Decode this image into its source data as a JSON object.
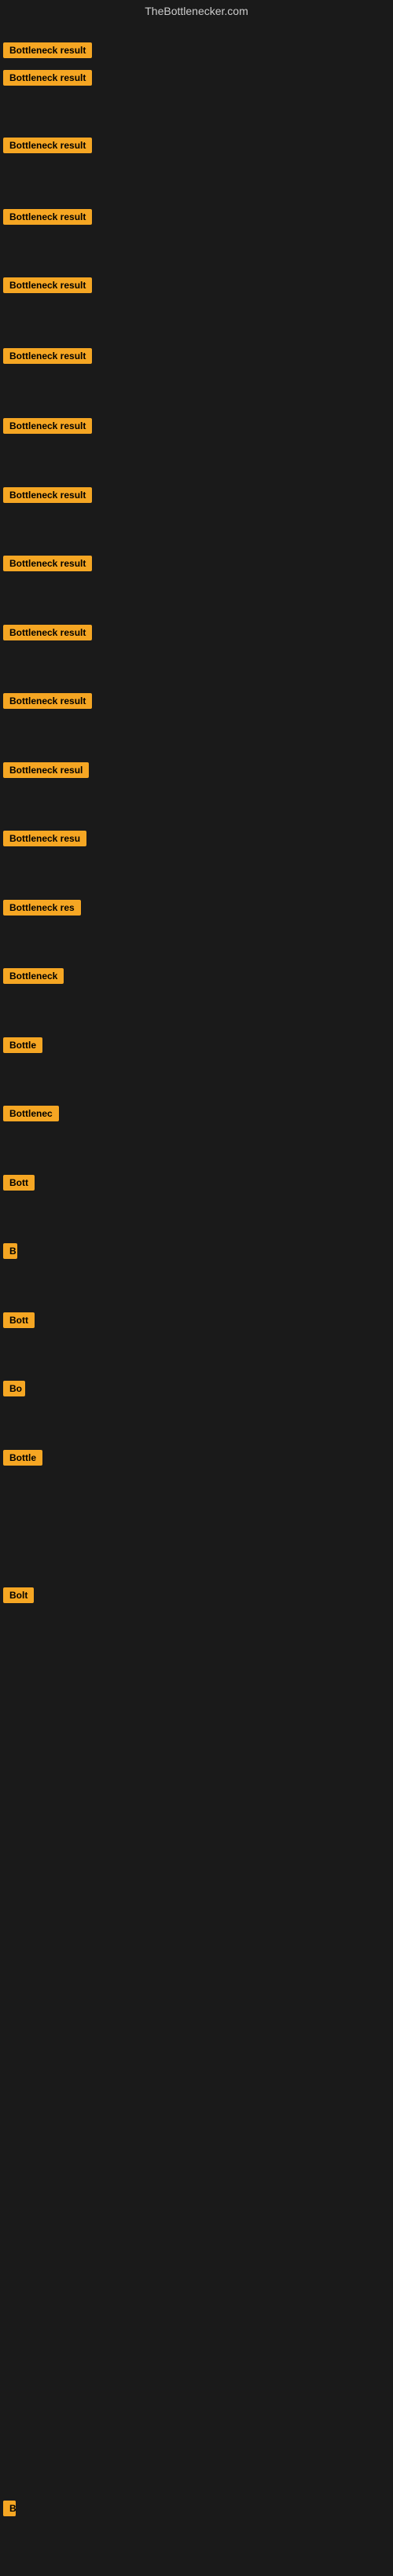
{
  "site": {
    "title": "TheBottlenecker.com"
  },
  "rows": [
    {
      "id": 1,
      "badge": "Bottleneck result",
      "badgeWidth": 155,
      "offsetTop": 22
    },
    {
      "id": 2,
      "badge": "Bottleneck result",
      "badgeWidth": 155,
      "offsetTop": 57
    },
    {
      "id": 3,
      "badge": "Bottleneck result",
      "badgeWidth": 155,
      "offsetTop": 143
    },
    {
      "id": 4,
      "badge": "Bottleneck result",
      "badgeWidth": 154,
      "offsetTop": 234
    },
    {
      "id": 5,
      "badge": "Bottleneck result",
      "badgeWidth": 150,
      "offsetTop": 321
    },
    {
      "id": 6,
      "badge": "Bottleneck result",
      "badgeWidth": 151,
      "offsetTop": 411
    },
    {
      "id": 7,
      "badge": "Bottleneck result",
      "badgeWidth": 155,
      "offsetTop": 500
    },
    {
      "id": 8,
      "badge": "Bottleneck result",
      "badgeWidth": 152,
      "offsetTop": 588
    },
    {
      "id": 9,
      "badge": "Bottleneck result",
      "badgeWidth": 151,
      "offsetTop": 675
    },
    {
      "id": 10,
      "badge": "Bottleneck result",
      "badgeWidth": 144,
      "offsetTop": 763
    },
    {
      "id": 11,
      "badge": "Bottleneck result",
      "badgeWidth": 144,
      "offsetTop": 850
    },
    {
      "id": 12,
      "badge": "Bottleneck resul",
      "badgeWidth": 135,
      "offsetTop": 938
    },
    {
      "id": 13,
      "badge": "Bottleneck resu",
      "badgeWidth": 128,
      "offsetTop": 1025
    },
    {
      "id": 14,
      "badge": "Bottleneck res",
      "badgeWidth": 120,
      "offsetTop": 1113
    },
    {
      "id": 15,
      "badge": "Bottleneck",
      "badgeWidth": 96,
      "offsetTop": 1200
    },
    {
      "id": 16,
      "badge": "Bottle",
      "badgeWidth": 60,
      "offsetTop": 1288
    },
    {
      "id": 17,
      "badge": "Bottlenec",
      "badgeWidth": 80,
      "offsetTop": 1375
    },
    {
      "id": 18,
      "badge": "Bott",
      "badgeWidth": 44,
      "offsetTop": 1463
    },
    {
      "id": 19,
      "badge": "B",
      "badgeWidth": 18,
      "offsetTop": 1550
    },
    {
      "id": 20,
      "badge": "Bott",
      "badgeWidth": 44,
      "offsetTop": 1638
    },
    {
      "id": 21,
      "badge": "Bo",
      "badgeWidth": 28,
      "offsetTop": 1725
    },
    {
      "id": 22,
      "badge": "Bottle",
      "badgeWidth": 58,
      "offsetTop": 1813
    },
    {
      "id": 23,
      "badge": "Bolt",
      "badgeWidth": 40,
      "offsetTop": 1988
    },
    {
      "id": 24,
      "badge": "",
      "badgeWidth": 0,
      "offsetTop": 2088
    },
    {
      "id": 25,
      "badge": "",
      "badgeWidth": 0,
      "offsetTop": 2200
    },
    {
      "id": 26,
      "badge": "",
      "badgeWidth": 0,
      "offsetTop": 2313
    },
    {
      "id": 27,
      "badge": "",
      "badgeWidth": 0,
      "offsetTop": 2425
    },
    {
      "id": 28,
      "badge": "",
      "badgeWidth": 0,
      "offsetTop": 2538
    },
    {
      "id": 29,
      "badge": "",
      "badgeWidth": 0,
      "offsetTop": 2650
    },
    {
      "id": 30,
      "badge": "",
      "badgeWidth": 0,
      "offsetTop": 2763
    },
    {
      "id": 31,
      "badge": "",
      "badgeWidth": 0,
      "offsetTop": 2875
    },
    {
      "id": 32,
      "badge": "B",
      "badgeWidth": 16,
      "offsetTop": 3150
    }
  ]
}
